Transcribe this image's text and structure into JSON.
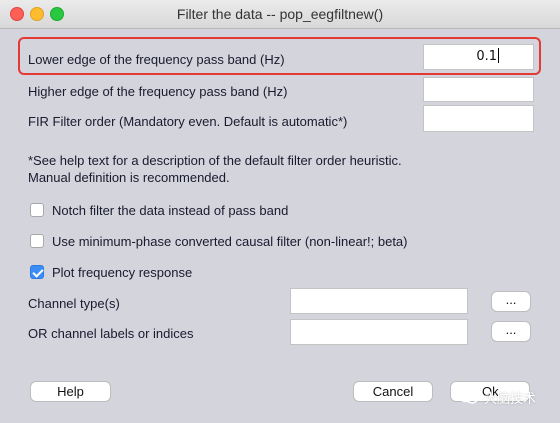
{
  "window": {
    "title": "Filter the data -- pop_eegfiltnew()"
  },
  "fields": {
    "lower_edge": {
      "label": "Lower edge of the frequency pass band (Hz)",
      "value": "0.1"
    },
    "higher_edge": {
      "label": "Higher edge of the frequency pass band (Hz)",
      "value": ""
    },
    "fir_order": {
      "label": "FIR Filter order (Mandatory even. Default is automatic*)",
      "value": ""
    }
  },
  "help_text": {
    "line1": "*See help text for a description of the default filter order heuristic.",
    "line2": "Manual definition is recommended."
  },
  "checkboxes": {
    "notch": {
      "label": "Notch filter the data instead of pass band",
      "checked": false
    },
    "min_phase": {
      "label": "Use minimum-phase converted causal filter (non-linear!; beta)",
      "checked": false
    },
    "plot_freq": {
      "label": "Plot frequency response",
      "checked": true
    }
  },
  "channels": {
    "type_label": "Channel type(s)",
    "type_value": "",
    "labels_label": "OR channel labels or indices",
    "labels_value": "",
    "browse_label": "..."
  },
  "buttons": {
    "help": "Help",
    "cancel": "Cancel",
    "ok": "Ok"
  },
  "watermark": {
    "text": "大脑技术"
  },
  "colors": {
    "highlight": "#e53935",
    "checkbox_accent": "#3a8cf6"
  }
}
